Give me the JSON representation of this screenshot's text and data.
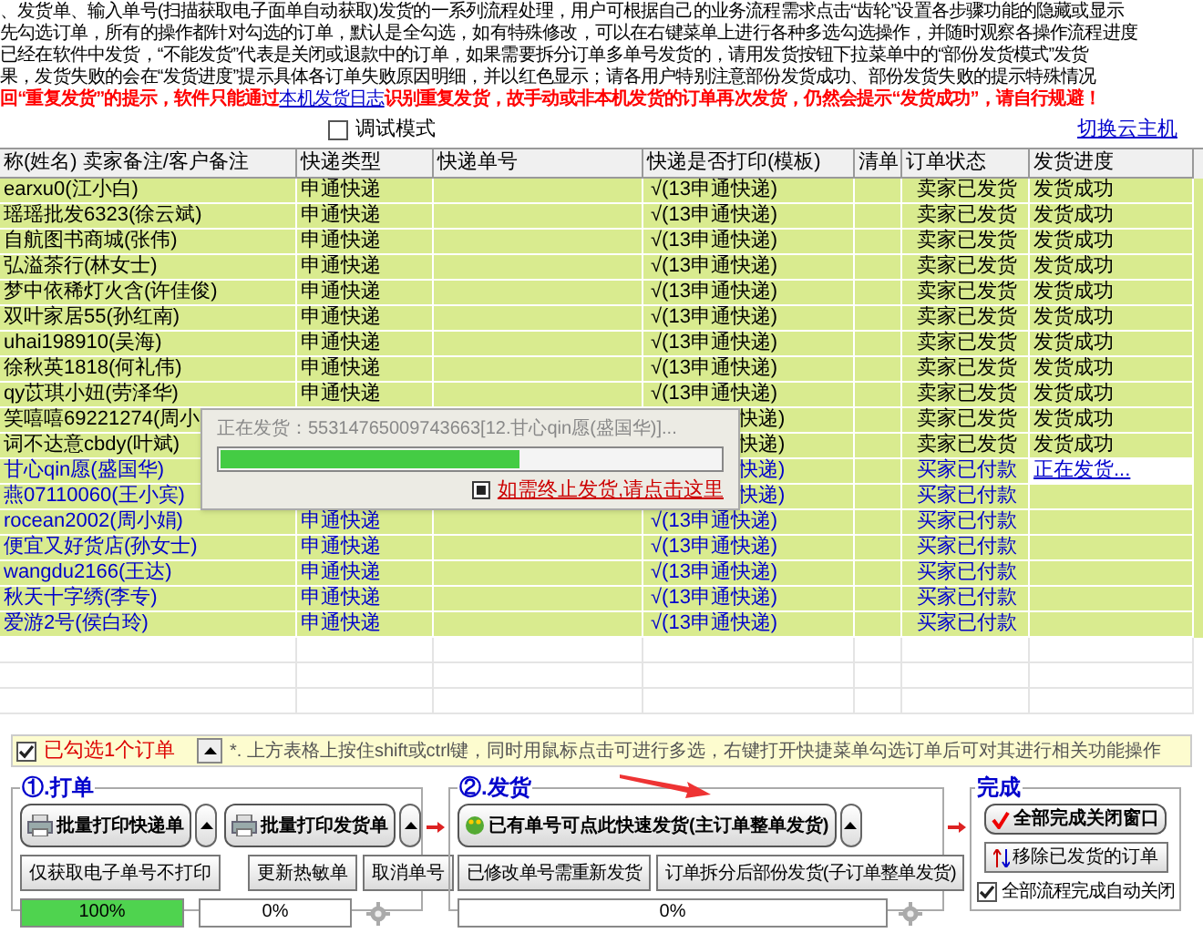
{
  "intro_lines": [
    "、发货单、输入单号(扫描获取电子面单自动获取)发货的一系列流程处理，用户可根据自己的业务流程需求点击“齿轮”设置各步骤功能的隐藏或显示",
    "先勾选订单，所有的操作都针对勾选的订单，默认是全勾选，如有特殊修改，可以在右键菜单上进行各种多选勾选操作，并随时观察各操作流程进度",
    "已经在软件中发货，“不能发货”代表是关闭或退款中的订单，如果需要拆分订单多单号发货的，请用发货按钮下拉菜单中的“部份发货模式”发货",
    "果，发货失败的会在“发货进度”提示具体各订单失败原因明细，并以红色显示；请各用户特别注意部份发货成功、部份发货失败的提示特殊情况"
  ],
  "warning": {
    "before": "回“重复发货”的提示，软件只能通过",
    "link": "本机发货日志",
    "after": "识别重复发货，故手动或非本机发货的订单再次发货，仍然会提示“发货成功”，请自行规避！"
  },
  "debug_mode": {
    "label": "调试模式",
    "checked": false
  },
  "switch_host_link": "切换云主机",
  "table": {
    "columns": [
      "称(姓名) 卖家备注/客户备注",
      "快递类型",
      "快递单号",
      "快递是否打印(模板)",
      "清单",
      "订单状态",
      "发货进度"
    ],
    "rows": [
      {
        "kind": "full",
        "name": "earxu0(江小白)",
        "express_type": "申通快递",
        "print": "√(13申通快递)",
        "status": "卖家已发货",
        "progress": "发货成功",
        "shipped": true,
        "in_progress": false
      },
      {
        "kind": "full",
        "name": "瑶瑶批发6323(徐云斌)",
        "express_type": "申通快递",
        "print": "√(13申通快递)",
        "status": "卖家已发货",
        "progress": "发货成功",
        "shipped": true,
        "in_progress": false
      },
      {
        "kind": "full",
        "name": "自航图书商城(张伟)",
        "express_type": "申通快递",
        "print": "√(13申通快递)",
        "status": "卖家已发货",
        "progress": "发货成功",
        "shipped": true,
        "in_progress": false
      },
      {
        "kind": "full",
        "name": "弘溢茶行(林女士)",
        "express_type": "申通快递",
        "print": "√(13申通快递)",
        "status": "卖家已发货",
        "progress": "发货成功",
        "shipped": true,
        "in_progress": false
      },
      {
        "kind": "full",
        "name": "梦中依稀灯火含(许佳俊)",
        "express_type": "申通快递",
        "print": "√(13申通快递)",
        "status": "卖家已发货",
        "progress": "发货成功",
        "shipped": true,
        "in_progress": false
      },
      {
        "kind": "full",
        "name": "双叶家居55(孙红南)",
        "express_type": "申通快递",
        "print": "√(13申通快递)",
        "status": "卖家已发货",
        "progress": "发货成功",
        "shipped": true,
        "in_progress": false
      },
      {
        "kind": "full",
        "name": "uhai198910(吴海)",
        "express_type": "申通快递",
        "print": "√(13申通快递)",
        "status": "卖家已发货",
        "progress": "发货成功",
        "shipped": true,
        "in_progress": false
      },
      {
        "kind": "full",
        "name": "徐秋英1818(何礼伟)",
        "express_type": "申通快递",
        "print": "√(13申通快递)",
        "status": "卖家已发货",
        "progress": "发货成功",
        "shipped": true,
        "in_progress": false
      },
      {
        "kind": "full",
        "name": "qy苡琪小妞(劳泽华)",
        "express_type": "申通快递",
        "print": "√(13申通快递)",
        "status": "卖家已发货",
        "progress": "发货成功",
        "shipped": true,
        "in_progress": false
      },
      {
        "kind": "partly_hidden",
        "name": "笑嘻嘻69221274(周小",
        "print": "快递)",
        "status": "卖家已发货",
        "progress": "发货成功",
        "shipped": true,
        "in_progress": false
      },
      {
        "kind": "partly_hidden",
        "name": "词不达意cbdy(叶斌)",
        "print": "快递)",
        "status": "卖家已发货",
        "progress": "发货成功",
        "shipped": true,
        "in_progress": false
      },
      {
        "kind": "partly_hidden",
        "name": "甘心qin愿(盛国华)",
        "print": "快递)",
        "status": "买家已付款",
        "progress": "正在发货...",
        "shipped": false,
        "in_progress": true
      },
      {
        "kind": "partly_hidden",
        "name": "燕07110060(王小宾)",
        "print": "快递)",
        "status": "买家已付款",
        "shipped": false,
        "in_progress": false
      },
      {
        "kind": "full",
        "name": "rocean2002(周小娟)",
        "express_type": "申通快递",
        "print": "√(13申通快递)",
        "status": "买家已付款",
        "shipped": false,
        "in_progress": false
      },
      {
        "kind": "full",
        "name": "便宜又好货店(孙女士)",
        "express_type": "申通快递",
        "print": "√(13申通快递)",
        "status": "买家已付款",
        "shipped": false,
        "in_progress": false
      },
      {
        "kind": "full",
        "name": "wangdu2166(王达)",
        "express_type": "申通快递",
        "print": "√(13申通快递)",
        "status": "买家已付款",
        "shipped": false,
        "in_progress": false
      },
      {
        "kind": "full",
        "name": "秋天十字绣(李专)",
        "express_type": "申通快递",
        "print": "√(13申通快递)",
        "status": "买家已付款",
        "shipped": false,
        "in_progress": false
      },
      {
        "kind": "full",
        "name": "爱游2号(侯白玲)",
        "express_type": "申通快递",
        "print": "√(13申通快递)",
        "status": "买家已付款",
        "shipped": false,
        "in_progress": false
      }
    ]
  },
  "sending_dialog": {
    "message": "正在发货：55314765009743663[12.甘心qin愿(盛国华)]...",
    "level": 0.6,
    "stop_link": "如需终止发货,请点击这里"
  },
  "selection_bar": {
    "checked": true,
    "count_label": "已勾选1个订单",
    "hint": "*. 上方表格上按住shift或ctrl键，同时用鼠标点击可进行多选，右键打开快捷菜单勾选订单后可对其进行相关功能操作"
  },
  "print_group": {
    "title": "①.打单",
    "print_express_button": "批量打印快递单",
    "print_invoice_button": "批量打印发货单",
    "get_number_button": "仅获取电子单号不打印",
    "update_thermal_button": "更新热敏单",
    "cancel_number_button": "取消单号",
    "progress_left": {
      "level": 1,
      "reading": "100%"
    },
    "progress_right": {
      "level": 0,
      "reading": "0%"
    }
  },
  "ship_group": {
    "title": "②.发货",
    "quick_ship_button": "已有单号可点此快速发货(主订单整单发货)",
    "reship_button": "已修改单号需重新发货",
    "partial_ship_button": "订单拆分后部份发货(子订单整单发货)",
    "progress": {
      "level": 0,
      "reading": "0%"
    }
  },
  "finish_group": {
    "title": "完成",
    "close_button": "全部完成关闭窗口",
    "remove_button": "移除已发货的订单",
    "auto_close": {
      "label": "全部流程完成自动关闭",
      "checked": true
    }
  }
}
